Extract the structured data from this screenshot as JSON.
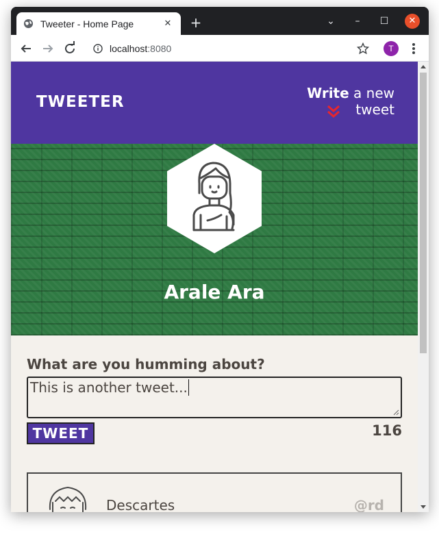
{
  "browser": {
    "tab_title": "Tweeter - Home Page",
    "tab_close": "✕",
    "new_tab": "+",
    "url_host": "localhost",
    "url_port": ":8080",
    "profile_initial": "T",
    "window_controls": {
      "chevron": "⌄",
      "minimize": "–",
      "maximize": "☐",
      "close": "✕"
    }
  },
  "header": {
    "brand": "TWEETER",
    "compose_bold": "Write",
    "compose_rest": " a new tweet"
  },
  "profile": {
    "name": "Arale Ara"
  },
  "compose": {
    "label": "What are you humming about?",
    "value": "This is another tweet...",
    "submit_label": "TWEET",
    "counter": "116"
  },
  "tweets": [
    {
      "author": "Descartes",
      "handle": "@rd"
    }
  ],
  "colors": {
    "header_bg": "#4f36a0",
    "banner_bg": "#2f7a43",
    "page_bg": "#f4f1ec",
    "chevron": "#e8262c"
  }
}
